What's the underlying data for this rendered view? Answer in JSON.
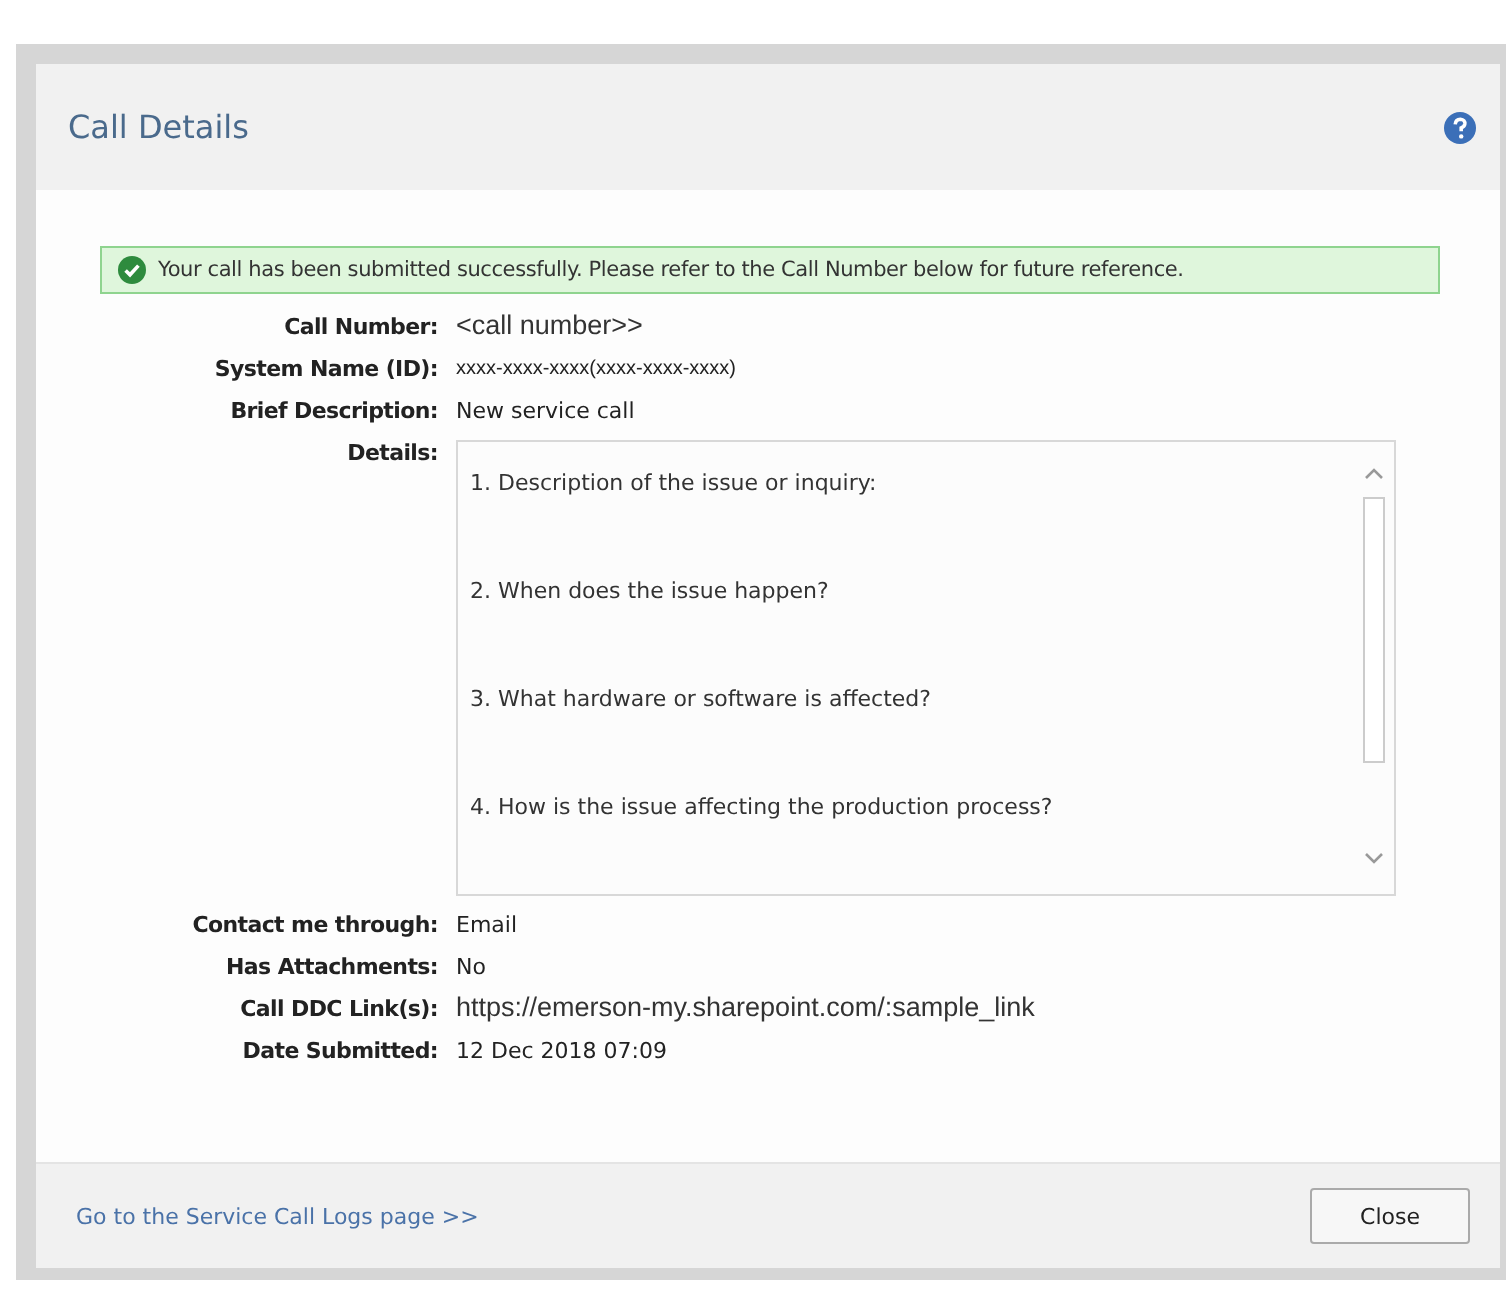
{
  "dialog": {
    "title": "Call Details"
  },
  "banner": {
    "kind": "success",
    "message": "Your call has been submitted successfully. Please refer to the Call Number below for future reference."
  },
  "fields": [
    {
      "label": "Call Number:",
      "value": "<call number>>",
      "kind": "large"
    },
    {
      "label": "System Name (ID):",
      "value": "xxxx-xxxx-xxxx(xxxx-xxxx-xxxx)",
      "kind": "small"
    },
    {
      "label": "Brief Description:",
      "value": "New service call",
      "kind": "normal"
    },
    {
      "label": "Details:",
      "kind": "textarea",
      "lines": [
        "1. Description of the issue or inquiry:",
        "2. When does the issue happen?",
        "3. What hardware or software is affected?",
        "4. How is the issue affecting the production process?"
      ]
    },
    {
      "label": "Contact me through:",
      "value": "Email",
      "kind": "normal"
    },
    {
      "label": "Has Attachments:",
      "value": "No",
      "kind": "normal"
    },
    {
      "label": "Call DDC Link(s):",
      "value": "https://emerson-my.sharepoint.com/:sample_link",
      "kind": "large"
    },
    {
      "label": "Date Submitted:",
      "value": "12 Dec 2018 07:09",
      "kind": "normal"
    }
  ],
  "footer": {
    "link": "Go to the Service Call Logs page >>",
    "button": "Close"
  }
}
